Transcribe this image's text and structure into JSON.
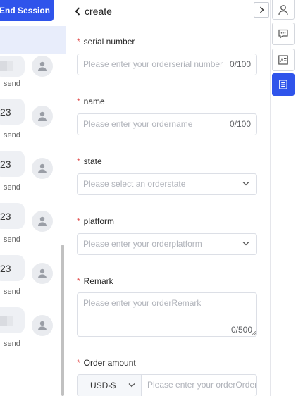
{
  "chat": {
    "end_session_label": "End Session",
    "messages": [
      {
        "text": "",
        "send_label": "send",
        "blurred": true
      },
      {
        "text": "23",
        "send_label": "send",
        "blurred": false
      },
      {
        "text": "23",
        "send_label": "send",
        "blurred": false
      },
      {
        "text": "23",
        "send_label": "send",
        "blurred": false
      },
      {
        "text": "23",
        "send_label": "send",
        "blurred": false
      },
      {
        "text": "",
        "send_label": "send",
        "blurred": true
      }
    ]
  },
  "form": {
    "back_label": "create",
    "fields": {
      "serial_number": {
        "label": "serial number",
        "placeholder": "Please enter your orderserial number",
        "count": "0/100"
      },
      "name": {
        "label": "name",
        "placeholder": "Please enter your ordername",
        "count": "0/100"
      },
      "state": {
        "label": "state",
        "placeholder": "Please select an orderstate"
      },
      "platform": {
        "label": "platform",
        "placeholder": "Please enter your orderplatform"
      },
      "remark": {
        "label": "Remark",
        "placeholder": "Please enter your orderRemark",
        "count": "0/500"
      },
      "order_amount": {
        "label": "Order amount",
        "currency": "USD-$",
        "placeholder": "Please enter your orderOrder amount"
      }
    },
    "required_mark": "*"
  },
  "rail": {
    "items": [
      {
        "icon": "user-icon",
        "active": false
      },
      {
        "icon": "chat-bubble-icon",
        "active": false
      },
      {
        "icon": "id-card-icon",
        "active": false
      },
      {
        "icon": "order-list-icon",
        "active": true
      }
    ]
  },
  "colors": {
    "accent": "#2f54eb",
    "required": "#e34d4d",
    "placeholder": "#b0b3ba"
  }
}
